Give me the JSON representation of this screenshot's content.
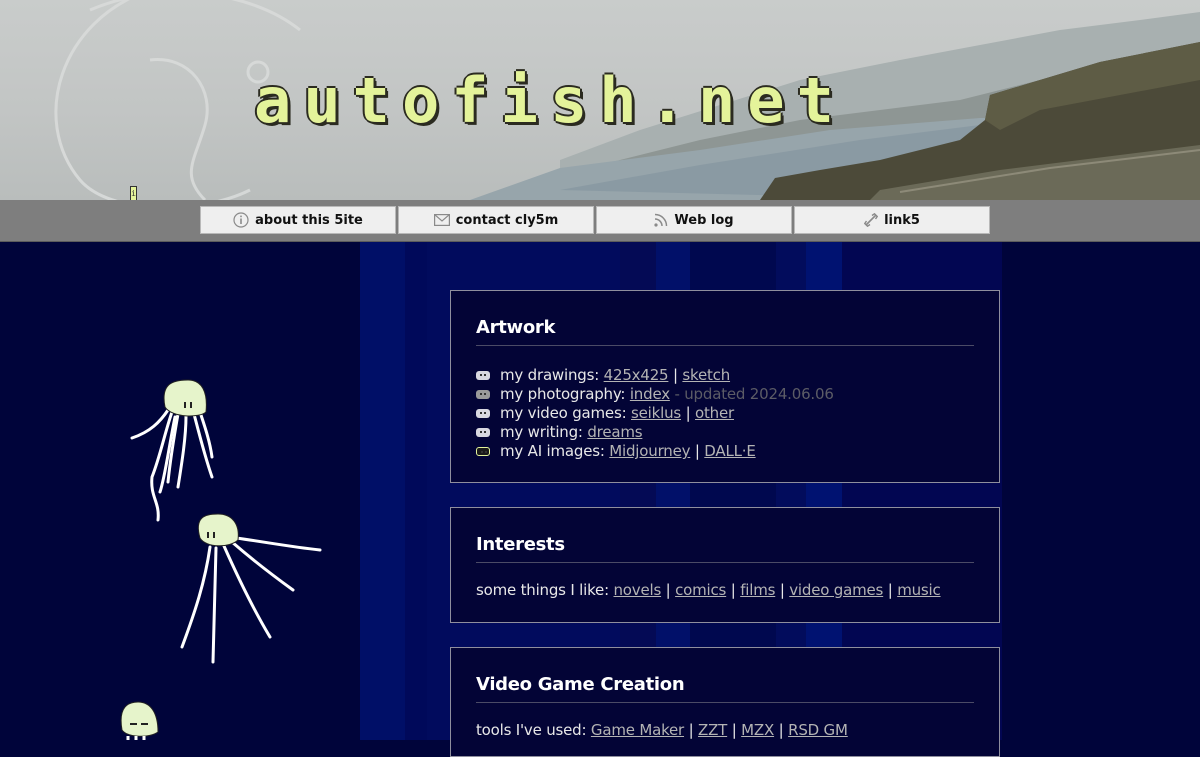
{
  "site": {
    "title": "autofish.net",
    "info_marker": "i"
  },
  "nav": [
    {
      "label": "about this 5ite",
      "icon": "info-icon"
    },
    {
      "label": "contact cly5m",
      "icon": "envelope-icon"
    },
    {
      "label": "Web log",
      "icon": "rss-icon"
    },
    {
      "label": "link5",
      "icon": "link-icon"
    }
  ],
  "artwork": {
    "heading": "Artwork",
    "drawings": {
      "label": "my drawings:",
      "links": [
        "425x425",
        "sketch"
      ]
    },
    "photography": {
      "label": "my photography:",
      "link": "index",
      "note": "- updated 2024.06.06"
    },
    "games": {
      "label": "my video games:",
      "links": [
        "seiklus",
        "other"
      ]
    },
    "writing": {
      "label": "my writing:",
      "link": "dreams"
    },
    "ai": {
      "label": "my AI images:",
      "links": [
        "Midjourney",
        "DALL·E"
      ]
    },
    "separator": "|"
  },
  "interests": {
    "heading": "Interests",
    "label": "some things I like:",
    "links": [
      "novels",
      "comics",
      "films",
      "video games",
      "music"
    ]
  },
  "gamedev": {
    "heading": "Video Game Creation",
    "label": "tools I've used:",
    "links": [
      "Game Maker",
      "ZZT",
      "MZX",
      "RSD GM"
    ]
  },
  "colors": {
    "page_bg": "#00043a",
    "title_fill": "#e4f39a",
    "navbar": "#7e7e7e",
    "nav_button": "#efefef",
    "link": "#b4b4b4",
    "jelly": "#e6f4cb"
  }
}
